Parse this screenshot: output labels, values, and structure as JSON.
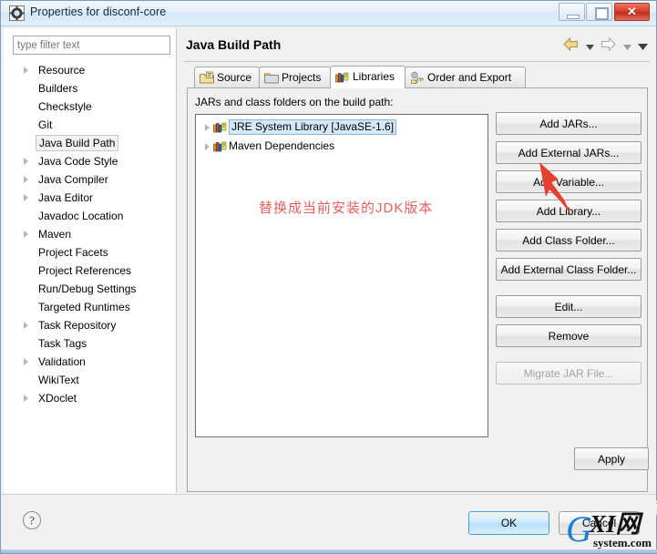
{
  "window": {
    "title": "Properties for disconf-core",
    "icon": "settings-gear-icon",
    "minimize_label": "",
    "maximize_label": "",
    "close_label": "✕"
  },
  "sidebar": {
    "filter": {
      "value": "",
      "placeholder": "type filter text"
    },
    "items": [
      {
        "label": "Resource",
        "expandable": true,
        "selected": false
      },
      {
        "label": "Builders",
        "expandable": false,
        "selected": false
      },
      {
        "label": "Checkstyle",
        "expandable": false,
        "selected": false
      },
      {
        "label": "Git",
        "expandable": false,
        "selected": false
      },
      {
        "label": "Java Build Path",
        "expandable": false,
        "selected": true
      },
      {
        "label": "Java Code Style",
        "expandable": true,
        "selected": false
      },
      {
        "label": "Java Compiler",
        "expandable": true,
        "selected": false
      },
      {
        "label": "Java Editor",
        "expandable": true,
        "selected": false
      },
      {
        "label": "Javadoc Location",
        "expandable": false,
        "selected": false
      },
      {
        "label": "Maven",
        "expandable": true,
        "selected": false
      },
      {
        "label": "Project Facets",
        "expandable": false,
        "selected": false
      },
      {
        "label": "Project References",
        "expandable": false,
        "selected": false
      },
      {
        "label": "Run/Debug Settings",
        "expandable": false,
        "selected": false
      },
      {
        "label": "Targeted Runtimes",
        "expandable": false,
        "selected": false
      },
      {
        "label": "Task Repository",
        "expandable": true,
        "selected": false
      },
      {
        "label": "Task Tags",
        "expandable": false,
        "selected": false
      },
      {
        "label": "Validation",
        "expandable": true,
        "selected": false
      },
      {
        "label": "WikiText",
        "expandable": false,
        "selected": false
      },
      {
        "label": "XDoclet",
        "expandable": true,
        "selected": false
      }
    ]
  },
  "page": {
    "title": "Java Build Path",
    "nav": {
      "back_icon": "back-arrow-icon",
      "back_menu_icon": "chevron-down-icon",
      "forward_icon": "forward-arrow-icon",
      "forward_menu_icon": "chevron-down-icon",
      "view_menu_icon": "chevron-down-icon"
    },
    "tabs": [
      {
        "label": "Source",
        "icon": "source-folder-icon",
        "active": false
      },
      {
        "label": "Projects",
        "icon": "projects-folder-icon",
        "active": false
      },
      {
        "label": "Libraries",
        "icon": "library-books-icon",
        "active": true
      },
      {
        "label": "Order and Export",
        "icon": "order-export-icon",
        "active": false
      }
    ],
    "libraries_label": "JARs and class folders on the build path:",
    "library_entries": [
      {
        "label": "JRE System Library [JavaSE-1.6]",
        "icon": "library-books-icon",
        "selected": true,
        "expandable": true
      },
      {
        "label": "Maven Dependencies",
        "icon": "library-books-icon",
        "selected": false,
        "expandable": true
      }
    ],
    "side_buttons": [
      {
        "label": "Add JARs...",
        "enabled": true,
        "gap_before": false
      },
      {
        "label": "Add External JARs...",
        "enabled": true,
        "gap_before": false
      },
      {
        "label": "Add Variable...",
        "enabled": true,
        "gap_before": false
      },
      {
        "label": "Add Library...",
        "enabled": true,
        "gap_before": false
      },
      {
        "label": "Add Class Folder...",
        "enabled": true,
        "gap_before": false
      },
      {
        "label": "Add External Class Folder...",
        "enabled": true,
        "gap_before": false
      },
      {
        "label": "Edit...",
        "enabled": true,
        "gap_before": true
      },
      {
        "label": "Remove",
        "enabled": true,
        "gap_before": false
      },
      {
        "label": "Migrate JAR File...",
        "enabled": false,
        "gap_before": true
      }
    ],
    "apply_label": "Apply",
    "scrollbar": {
      "left_icon": "scroll-left-arrow-icon",
      "right_icon": "scroll-right-arrow-icon"
    }
  },
  "footer": {
    "help_icon": "help-question-icon",
    "ok_label": "OK",
    "cancel_label": "Cancel"
  },
  "annotation": {
    "text": "替换成当前安装的JDK版本",
    "color": "#e8605e",
    "arrow_icon": "red-pointer-arrow-icon"
  },
  "watermark": {
    "primary": "G",
    "secondary": "XI网",
    "tertiary": "system.com"
  }
}
